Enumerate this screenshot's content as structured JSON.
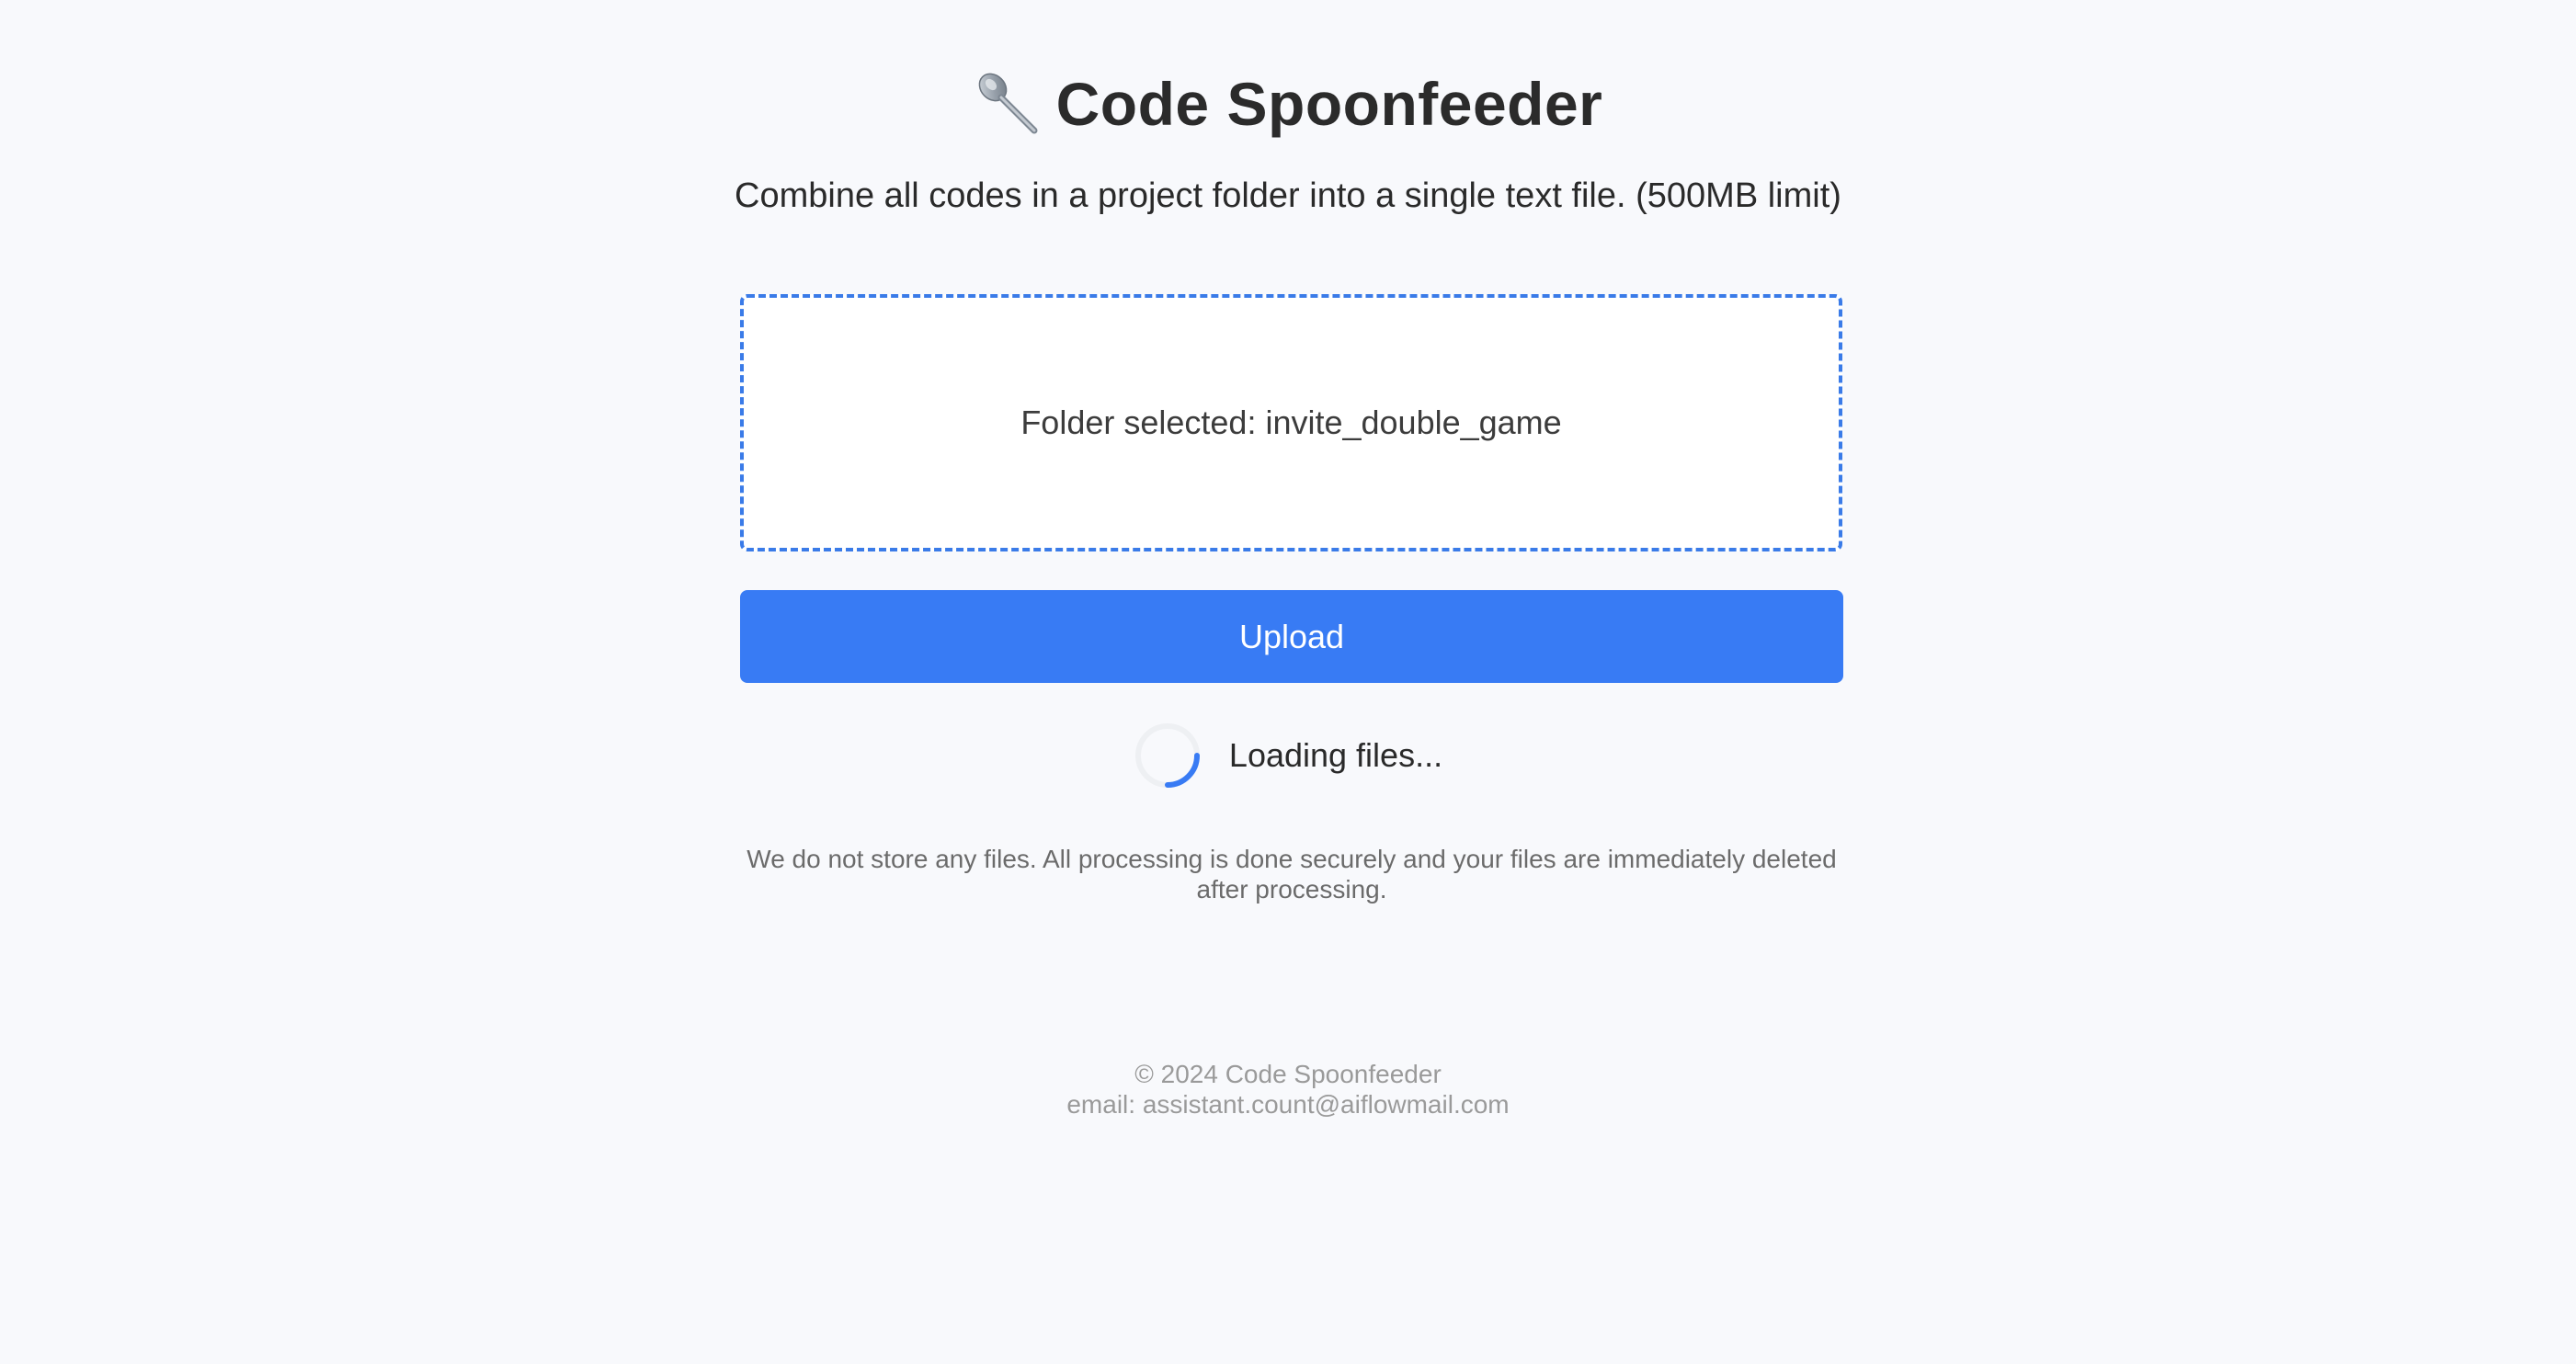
{
  "header": {
    "icon": "spoon-icon",
    "title": "Code Spoonfeeder",
    "subtitle": "Combine all codes in a project folder into a single text file. (500MB limit)"
  },
  "dropzone": {
    "status_text": "Folder selected: invite_double_game"
  },
  "upload_button": {
    "label": "Upload"
  },
  "loading": {
    "icon": "spinner-icon",
    "text": "Loading files..."
  },
  "privacy_note": "We do not store any files. All processing is done securely and your files are immediately deleted after processing.",
  "footer": {
    "copyright": "© 2024 Code Spoonfeeder",
    "email": "email: assistant.count@aiflowmail.com"
  },
  "colors": {
    "background": "#f8f9fc",
    "accent": "#387bf4",
    "dropzone_border": "#3a7be8",
    "muted_text": "#6b6b6b",
    "footer_text": "#9a9a9a"
  }
}
